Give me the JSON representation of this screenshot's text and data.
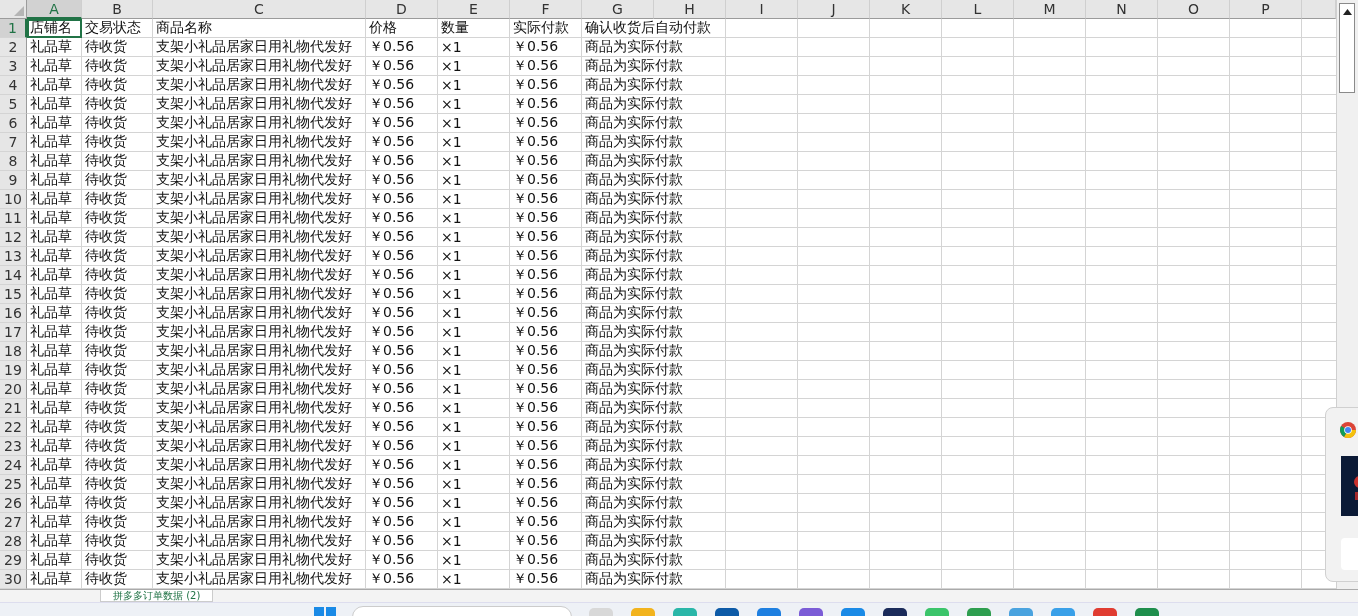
{
  "columns": [
    {
      "label": "A",
      "selected": true
    },
    {
      "label": "B",
      "selected": false
    },
    {
      "label": "C",
      "selected": false
    },
    {
      "label": "D",
      "selected": false
    },
    {
      "label": "E",
      "selected": false
    },
    {
      "label": "F",
      "selected": false
    },
    {
      "label": "G",
      "selected": false
    },
    {
      "label": "H",
      "selected": false
    },
    {
      "label": "I",
      "selected": false
    },
    {
      "label": "J",
      "selected": false
    },
    {
      "label": "K",
      "selected": false
    },
    {
      "label": "L",
      "selected": false
    },
    {
      "label": "M",
      "selected": false
    },
    {
      "label": "N",
      "selected": false
    },
    {
      "label": "O",
      "selected": false
    },
    {
      "label": "P",
      "selected": false
    }
  ],
  "rows": [
    {
      "number": "1",
      "selected": true,
      "cells": [
        "店铺名",
        "交易状态",
        "商品名称",
        "价格",
        "数量",
        "实际付款",
        "确认收货后自动付款"
      ]
    },
    {
      "number": "2",
      "selected": false,
      "cells": [
        "礼品草",
        "待收货",
        "支架小礼品居家日用礼物代发好",
        "￥0.56",
        "×1",
        "￥0.56",
        "商品为实际付款"
      ]
    },
    {
      "number": "3",
      "selected": false,
      "cells": [
        "礼品草",
        "待收货",
        "支架小礼品居家日用礼物代发好",
        "￥0.56",
        "×1",
        "￥0.56",
        "商品为实际付款"
      ]
    },
    {
      "number": "4",
      "selected": false,
      "cells": [
        "礼品草",
        "待收货",
        "支架小礼品居家日用礼物代发好",
        "￥0.56",
        "×1",
        "￥0.56",
        "商品为实际付款"
      ]
    },
    {
      "number": "5",
      "selected": false,
      "cells": [
        "礼品草",
        "待收货",
        "支架小礼品居家日用礼物代发好",
        "￥0.56",
        "×1",
        "￥0.56",
        "商品为实际付款"
      ]
    },
    {
      "number": "6",
      "selected": false,
      "cells": [
        "礼品草",
        "待收货",
        "支架小礼品居家日用礼物代发好",
        "￥0.56",
        "×1",
        "￥0.56",
        "商品为实际付款"
      ]
    },
    {
      "number": "7",
      "selected": false,
      "cells": [
        "礼品草",
        "待收货",
        "支架小礼品居家日用礼物代发好",
        "￥0.56",
        "×1",
        "￥0.56",
        "商品为实际付款"
      ]
    },
    {
      "number": "8",
      "selected": false,
      "cells": [
        "礼品草",
        "待收货",
        "支架小礼品居家日用礼物代发好",
        "￥0.56",
        "×1",
        "￥0.56",
        "商品为实际付款"
      ]
    },
    {
      "number": "9",
      "selected": false,
      "cells": [
        "礼品草",
        "待收货",
        "支架小礼品居家日用礼物代发好",
        "￥0.56",
        "×1",
        "￥0.56",
        "商品为实际付款"
      ]
    },
    {
      "number": "10",
      "selected": false,
      "cells": [
        "礼品草",
        "待收货",
        "支架小礼品居家日用礼物代发好",
        "￥0.56",
        "×1",
        "￥0.56",
        "商品为实际付款"
      ]
    },
    {
      "number": "11",
      "selected": false,
      "cells": [
        "礼品草",
        "待收货",
        "支架小礼品居家日用礼物代发好",
        "￥0.56",
        "×1",
        "￥0.56",
        "商品为实际付款"
      ]
    },
    {
      "number": "12",
      "selected": false,
      "cells": [
        "礼品草",
        "待收货",
        "支架小礼品居家日用礼物代发好",
        "￥0.56",
        "×1",
        "￥0.56",
        "商品为实际付款"
      ]
    },
    {
      "number": "13",
      "selected": false,
      "cells": [
        "礼品草",
        "待收货",
        "支架小礼品居家日用礼物代发好",
        "￥0.56",
        "×1",
        "￥0.56",
        "商品为实际付款"
      ]
    },
    {
      "number": "14",
      "selected": false,
      "cells": [
        "礼品草",
        "待收货",
        "支架小礼品居家日用礼物代发好",
        "￥0.56",
        "×1",
        "￥0.56",
        "商品为实际付款"
      ]
    },
    {
      "number": "15",
      "selected": false,
      "cells": [
        "礼品草",
        "待收货",
        "支架小礼品居家日用礼物代发好",
        "￥0.56",
        "×1",
        "￥0.56",
        "商品为实际付款"
      ]
    },
    {
      "number": "16",
      "selected": false,
      "cells": [
        "礼品草",
        "待收货",
        "支架小礼品居家日用礼物代发好",
        "￥0.56",
        "×1",
        "￥0.56",
        "商品为实际付款"
      ]
    },
    {
      "number": "17",
      "selected": false,
      "cells": [
        "礼品草",
        "待收货",
        "支架小礼品居家日用礼物代发好",
        "￥0.56",
        "×1",
        "￥0.56",
        "商品为实际付款"
      ]
    },
    {
      "number": "18",
      "selected": false,
      "cells": [
        "礼品草",
        "待收货",
        "支架小礼品居家日用礼物代发好",
        "￥0.56",
        "×1",
        "￥0.56",
        "商品为实际付款"
      ]
    },
    {
      "number": "19",
      "selected": false,
      "cells": [
        "礼品草",
        "待收货",
        "支架小礼品居家日用礼物代发好",
        "￥0.56",
        "×1",
        "￥0.56",
        "商品为实际付款"
      ]
    },
    {
      "number": "20",
      "selected": false,
      "cells": [
        "礼品草",
        "待收货",
        "支架小礼品居家日用礼物代发好",
        "￥0.56",
        "×1",
        "￥0.56",
        "商品为实际付款"
      ]
    },
    {
      "number": "21",
      "selected": false,
      "cells": [
        "礼品草",
        "待收货",
        "支架小礼品居家日用礼物代发好",
        "￥0.56",
        "×1",
        "￥0.56",
        "商品为实际付款"
      ]
    },
    {
      "number": "22",
      "selected": false,
      "cells": [
        "礼品草",
        "待收货",
        "支架小礼品居家日用礼物代发好",
        "￥0.56",
        "×1",
        "￥0.56",
        "商品为实际付款"
      ]
    },
    {
      "number": "23",
      "selected": false,
      "cells": [
        "礼品草",
        "待收货",
        "支架小礼品居家日用礼物代发好",
        "￥0.56",
        "×1",
        "￥0.56",
        "商品为实际付款"
      ]
    },
    {
      "number": "24",
      "selected": false,
      "cells": [
        "礼品草",
        "待收货",
        "支架小礼品居家日用礼物代发好",
        "￥0.56",
        "×1",
        "￥0.56",
        "商品为实际付款"
      ]
    },
    {
      "number": "25",
      "selected": false,
      "cells": [
        "礼品草",
        "待收货",
        "支架小礼品居家日用礼物代发好",
        "￥0.56",
        "×1",
        "￥0.56",
        "商品为实际付款"
      ]
    },
    {
      "number": "26",
      "selected": false,
      "cells": [
        "礼品草",
        "待收货",
        "支架小礼品居家日用礼物代发好",
        "￥0.56",
        "×1",
        "￥0.56",
        "商品为实际付款"
      ]
    },
    {
      "number": "27",
      "selected": false,
      "cells": [
        "礼品草",
        "待收货",
        "支架小礼品居家日用礼物代发好",
        "￥0.56",
        "×1",
        "￥0.56",
        "商品为实际付款"
      ]
    },
    {
      "number": "28",
      "selected": false,
      "cells": [
        "礼品草",
        "待收货",
        "支架小礼品居家日用礼物代发好",
        "￥0.56",
        "×1",
        "￥0.56",
        "商品为实际付款"
      ]
    },
    {
      "number": "29",
      "selected": false,
      "cells": [
        "礼品草",
        "待收货",
        "支架小礼品居家日用礼物代发好",
        "￥0.56",
        "×1",
        "￥0.56",
        "商品为实际付款"
      ]
    },
    {
      "number": "30",
      "selected": false,
      "cells": [
        "礼品草",
        "待收货",
        "支架小礼品居家日用礼物代发好",
        "￥0.56",
        "×1",
        "￥0.56",
        "商品为实际付款"
      ]
    }
  ],
  "sheet_tabs": [
    {
      "label": "拼多多订单数据 (2)",
      "selected": true
    }
  ]
}
